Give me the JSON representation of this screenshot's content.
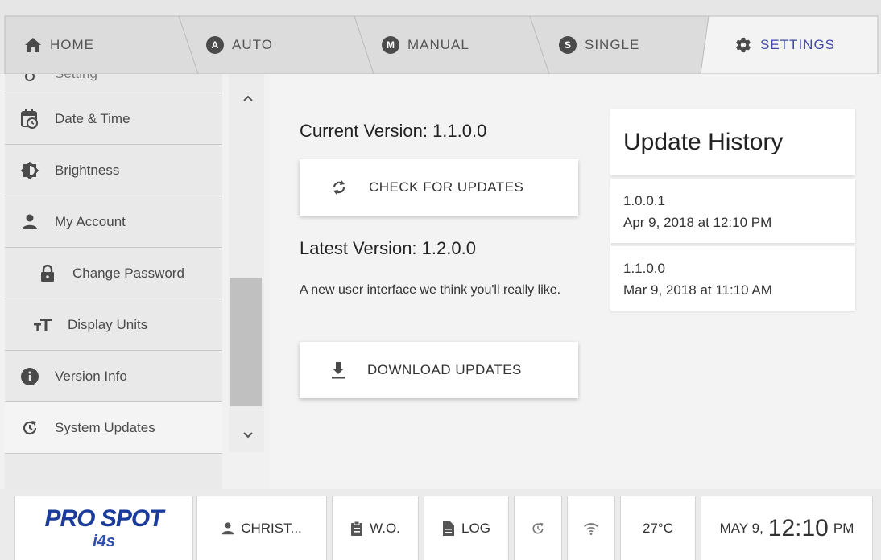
{
  "tabs": [
    {
      "label": "HOME",
      "icon": "home-icon"
    },
    {
      "label": "AUTO",
      "badge": "A"
    },
    {
      "label": "MANUAL",
      "badge": "M"
    },
    {
      "label": "SINGLE",
      "badge": "S"
    },
    {
      "label": "SETTINGS",
      "icon": "gear-icon",
      "active": true
    }
  ],
  "sidebar": {
    "items": [
      {
        "label": "Setting",
        "icon": "circle-icon"
      },
      {
        "label": "Date & Time",
        "icon": "calendar-clock-icon"
      },
      {
        "label": "Brightness",
        "icon": "brightness-icon"
      },
      {
        "label": "My Account",
        "icon": "person-icon"
      },
      {
        "label": "Change Password",
        "icon": "lock-icon"
      },
      {
        "label": "Display Units",
        "icon": "text-size-icon"
      },
      {
        "label": "Version Info",
        "icon": "info-icon"
      },
      {
        "label": "System Updates",
        "icon": "refresh-icon"
      }
    ]
  },
  "main": {
    "current_version": "Current Version: 1.1.0.0",
    "check_button": "CHECK FOR UPDATES",
    "latest_version": "Latest Version: 1.2.0.0",
    "description": "A new user interface we think you'll really like.",
    "download_button": "DOWNLOAD UPDATES"
  },
  "history": {
    "title": "Update History",
    "entries": [
      {
        "version": "1.0.0.1",
        "date": "Apr 9, 2018 at 12:10 PM"
      },
      {
        "version": "1.1.0.0",
        "date": "Mar 9, 2018 at 11:10 AM"
      }
    ]
  },
  "statusbar": {
    "logo_title": "PRO SPOT",
    "logo_sub": "i4s",
    "user": "CHRIST...",
    "wo": "W.O.",
    "log": "LOG",
    "temperature": "27°C",
    "date": "MAY 9,",
    "time": "12:10",
    "ampm": "PM"
  },
  "colors": {
    "accent": "#3f47a8",
    "logo_blue": "#1c3c9c",
    "logo_red": "#e0202a"
  }
}
